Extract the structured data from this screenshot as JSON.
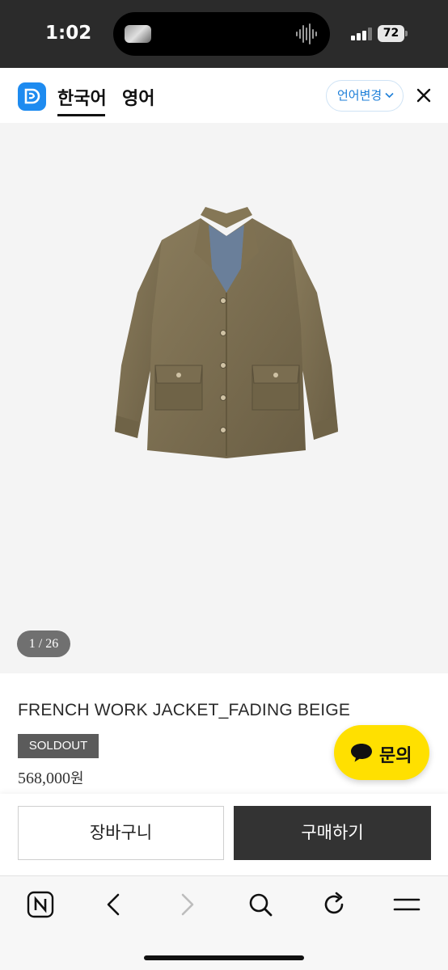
{
  "status_bar": {
    "time": "1:02",
    "battery": "72"
  },
  "header": {
    "lang_tabs": [
      "한국어",
      "영어"
    ],
    "lang_change_label": "언어변경",
    "icons": {
      "logo": "app-logo",
      "chevron": "chevron-down-icon",
      "close": "close-icon"
    }
  },
  "gallery": {
    "counter": "1 / 26"
  },
  "product": {
    "title": "FRENCH WORK JACKET_FADING BEIGE",
    "badge": "SOLDOUT",
    "price": "568,000",
    "price_unit": "원"
  },
  "inquiry": {
    "label": "문의",
    "icon": "chat-bubble-icon"
  },
  "actions": {
    "cart_label": "장바구니",
    "buy_label": "구매하기"
  },
  "browser_toolbar": {
    "icons": [
      "naver-home-icon",
      "back-icon",
      "forward-icon",
      "search-icon",
      "reload-icon",
      "menu-icon"
    ]
  },
  "colors": {
    "accent_blue": "#1e8bf0",
    "inquiry_yellow": "#ffe000",
    "buy_button": "#333333",
    "soldout_badge": "#5b5b5b"
  }
}
